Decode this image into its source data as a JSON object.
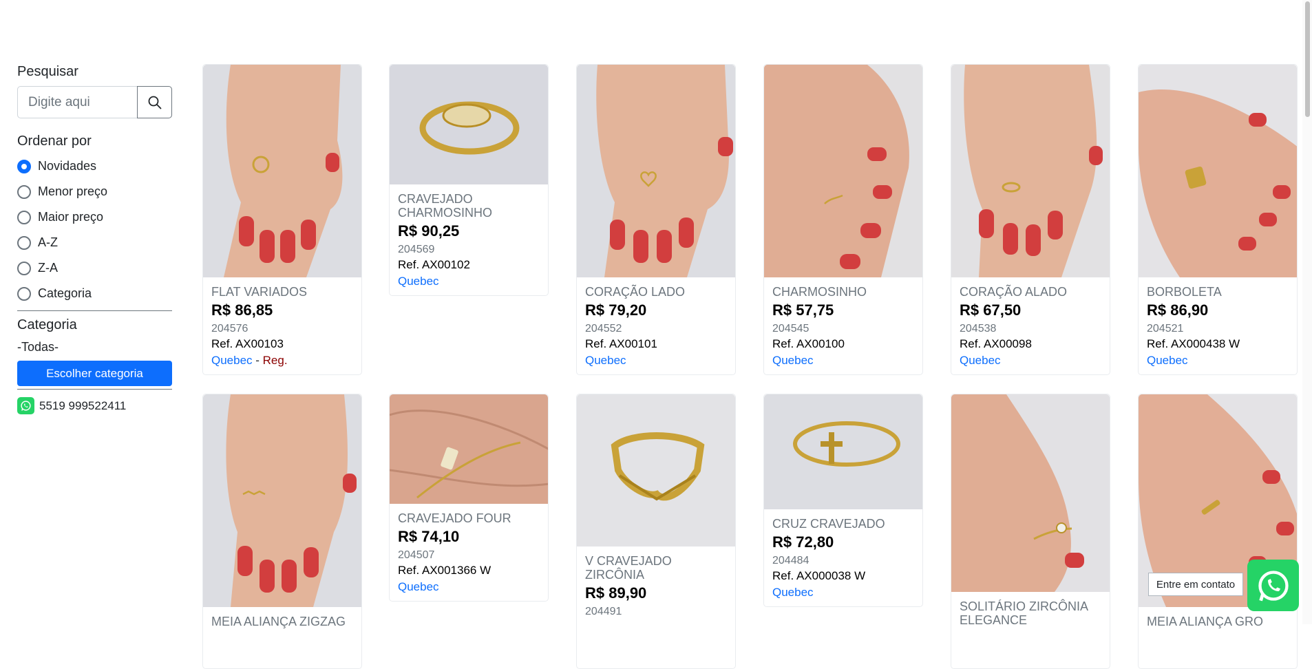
{
  "sidebar": {
    "search_label": "Pesquisar",
    "search_placeholder": "Digite aqui",
    "sort_label": "Ordenar por",
    "sort_options": [
      "Novidades",
      "Menor preço",
      "Maior preço",
      "A-Z",
      "Z-A",
      "Categoria"
    ],
    "sort_selected": "Novidades",
    "category_label": "Categoria",
    "category_value": "-Todas-",
    "category_button": "Escolher categoria",
    "phone": "5519 999522411"
  },
  "products": [
    {
      "name": "FLAT VARIADOS",
      "price": "R$ 86,85",
      "code": "204576",
      "ref": "Ref. AX00103",
      "location": "Quebec",
      "extra": "Reg."
    },
    {
      "name": "CRAVEJADO CHARMOSINHO",
      "price": "R$ 90,25",
      "code": "204569",
      "ref": "Ref. AX00102",
      "location": "Quebec"
    },
    {
      "name": "CORAÇÃO LADO",
      "price": "R$ 79,20",
      "code": "204552",
      "ref": "Ref. AX00101",
      "location": "Quebec"
    },
    {
      "name": "CHARMOSINHO",
      "price": "R$ 57,75",
      "code": "204545",
      "ref": "Ref. AX00100",
      "location": "Quebec"
    },
    {
      "name": "CORAÇÃO ALADO",
      "price": "R$ 67,50",
      "code": "204538",
      "ref": "Ref. AX00098",
      "location": "Quebec"
    },
    {
      "name": "BORBOLETA",
      "price": "R$ 86,90",
      "code": "204521",
      "ref": "Ref. AX000438 W",
      "location": "Quebec"
    },
    {
      "name": "MEIA ALIANÇA ZIGZAG"
    },
    {
      "name": "CRAVEJADO FOUR",
      "price": "R$ 74,10",
      "code": "204507",
      "ref": "Ref. AX001366 W",
      "location": "Quebec"
    },
    {
      "name": "V CRAVEJADO ZIRCÔNIA",
      "price": "R$ 89,90",
      "code": "204491"
    },
    {
      "name": "CRUZ CRAVEJADO",
      "price": "R$ 72,80",
      "code": "204484",
      "ref": "Ref. AX000038 W",
      "location": "Quebec"
    },
    {
      "name": "SOLITÁRIO ZIRCÔNIA ELEGANCE"
    },
    {
      "name": "MEIA ALIANÇA GRO"
    }
  ],
  "contact_tooltip": "Entre em contato",
  "colors": {
    "accent": "#0d6efd",
    "whatsapp": "#25d366",
    "region": "#8b0000"
  }
}
